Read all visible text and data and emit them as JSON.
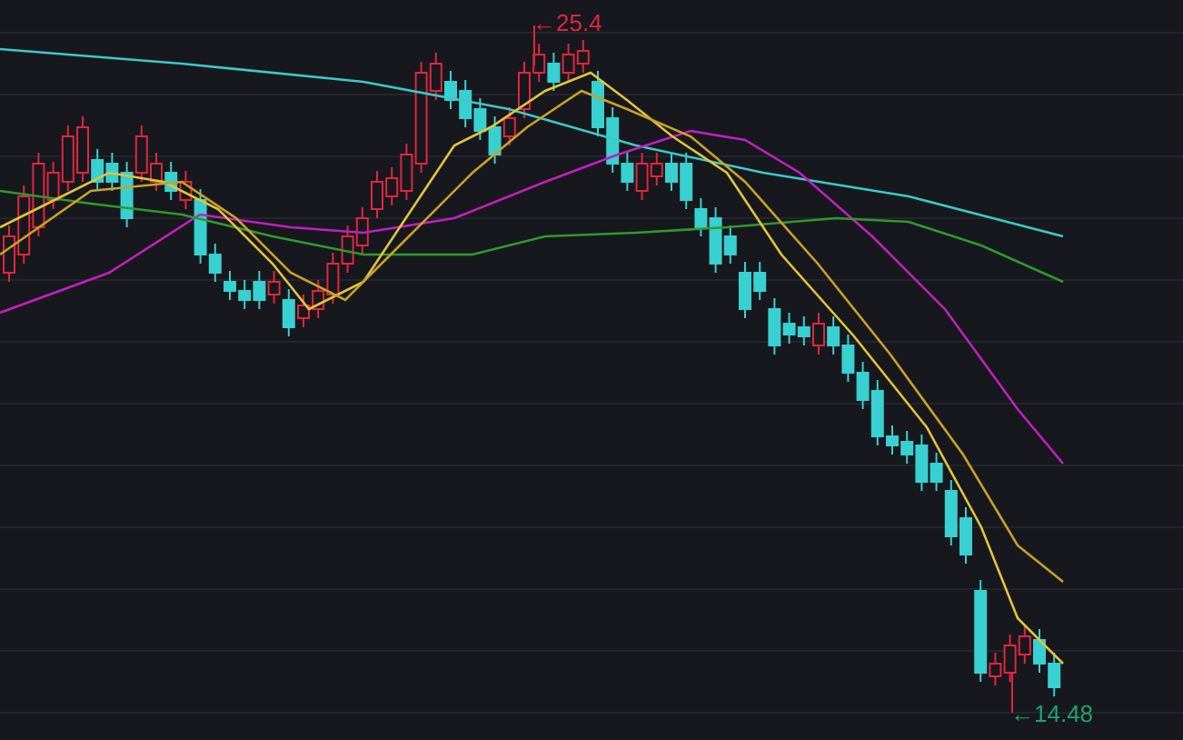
{
  "chart": {
    "high_label": "←25.4",
    "low_label": "←14.48"
  }
}
